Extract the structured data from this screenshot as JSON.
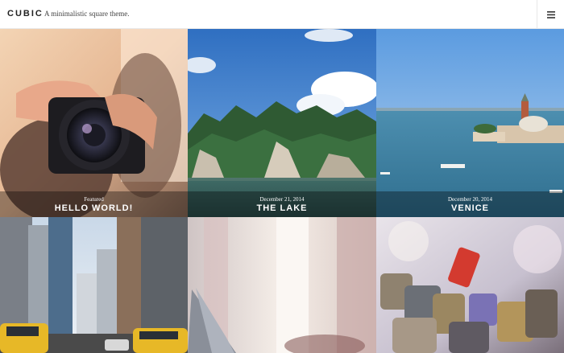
{
  "header": {
    "brand": "CUBIC",
    "tagline": "A minimalistic square theme."
  },
  "menu": {
    "icon": "hamburger-icon"
  },
  "posts": [
    {
      "meta": "Featured",
      "title": "HELLO WORLD!"
    },
    {
      "meta": "December 21, 2014",
      "title": "THE LAKE"
    },
    {
      "meta": "December 20, 2014",
      "title": "VENICE"
    }
  ]
}
